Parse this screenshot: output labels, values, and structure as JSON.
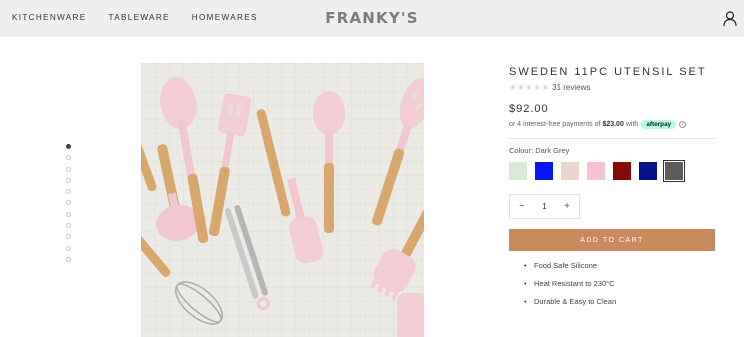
{
  "header": {
    "nav": [
      "KITCHENWARE",
      "TABLEWARE",
      "HOMEWARES"
    ],
    "logo": "FRANKY'S",
    "account_icon": "user-icon"
  },
  "gallery": {
    "dot_count": 11,
    "active_index": 0,
    "image_alt": "pink silicone utensils with wooden handles"
  },
  "product": {
    "title": "SWEDEN 11PC UTENSIL SET",
    "rating": 5,
    "reviews": "31 reviews",
    "price": "$92.00",
    "afterpay": {
      "prefix": "or 4 interest-free payments of",
      "amount": "$23.00",
      "with": "with",
      "badge": "afterpay",
      "info": "i"
    },
    "colour_label": "Colour: Dark Grey",
    "swatches": [
      {
        "color": "#d9ead7"
      },
      {
        "color": "#0a14ff"
      },
      {
        "color": "#e9d6cc"
      },
      {
        "color": "#f7c1cf"
      },
      {
        "color": "#870a0a"
      },
      {
        "color": "#071289"
      },
      {
        "color": "#5c5c5c",
        "selected": true
      }
    ],
    "quantity": "1",
    "minus": "−",
    "plus": "+",
    "add_to_cart": "ADD TO CART",
    "features": [
      "Food Safe Silicone",
      "Heat Resistant to 230°C",
      "Durable & Easy to Clean"
    ]
  }
}
